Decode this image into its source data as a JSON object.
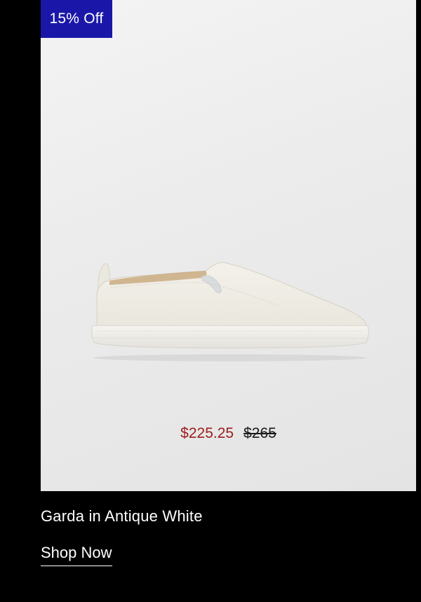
{
  "badge": {
    "label": "15% Off",
    "color": "#1a17a8"
  },
  "product": {
    "image_icon": "white-slip-on-sneaker",
    "sale_price": "$225.25",
    "original_price": "$265",
    "sale_price_color": "#9c1c1c",
    "name": "Garda in Antique White"
  },
  "cta": {
    "label": "Shop Now"
  }
}
